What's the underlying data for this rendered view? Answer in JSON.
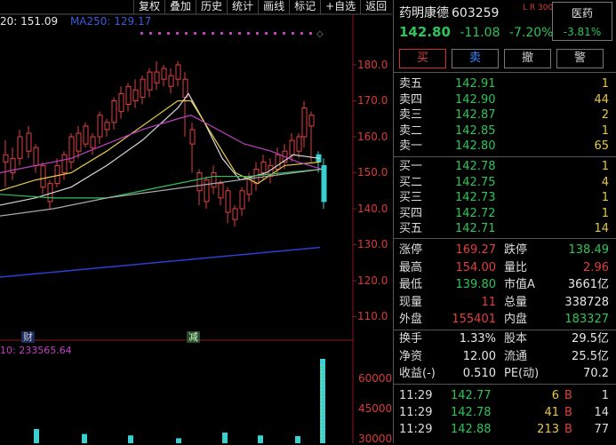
{
  "toolbar": {
    "items": [
      "复权",
      "叠加",
      "历史",
      "统计",
      "画线",
      "标记",
      "+自选",
      "返回"
    ]
  },
  "legend": {
    "ma20": "20: 151.09",
    "ma250": "MA250: 129.17"
  },
  "volume_legend": "10: 233565.64",
  "events": {
    "financial": "财",
    "reduction": "减"
  },
  "price_axis": [
    "180.0",
    "170.0",
    "160.0",
    "150.0",
    "140.0",
    "130.0",
    "120.0",
    "110.0"
  ],
  "volume_axis": [
    "60000",
    "45000",
    "30000"
  ],
  "stock": {
    "name": "药明康德",
    "code": "603259",
    "badge": "L R 300",
    "last": "142.80",
    "change": "-11.08",
    "change_pct": "-7.20%",
    "sector": "医药",
    "sector_change": "-3.81%"
  },
  "buttons": {
    "buy": "买",
    "sell": "卖",
    "cancel": "撤",
    "alert": "警"
  },
  "asks": [
    {
      "label": "卖五",
      "price": "142.91",
      "vol": "1"
    },
    {
      "label": "卖四",
      "price": "142.90",
      "vol": "44"
    },
    {
      "label": "卖三",
      "price": "142.87",
      "vol": "2"
    },
    {
      "label": "卖二",
      "price": "142.85",
      "vol": "1"
    },
    {
      "label": "卖一",
      "price": "142.80",
      "vol": "65"
    }
  ],
  "bids": [
    {
      "label": "买一",
      "price": "142.78",
      "vol": "1"
    },
    {
      "label": "买二",
      "price": "142.75",
      "vol": "4"
    },
    {
      "label": "买三",
      "price": "142.73",
      "vol": "1"
    },
    {
      "label": "买四",
      "price": "142.72",
      "vol": "1"
    },
    {
      "label": "买五",
      "price": "142.71",
      "vol": "14"
    }
  ],
  "stats": [
    {
      "l1": "涨停",
      "v1": "169.27",
      "c1": "red",
      "l2": "跌停",
      "v2": "138.49",
      "c2": "green"
    },
    {
      "l1": "最高",
      "v1": "154.00",
      "c1": "red",
      "l2": "量比",
      "v2": "2.96",
      "c2": "red"
    },
    {
      "l1": "最低",
      "v1": "139.80",
      "c1": "green",
      "l2": "市值A",
      "v2": "3661亿",
      "c2": "white"
    },
    {
      "l1": "现量",
      "v1": "11",
      "c1": "red",
      "l2": "总量",
      "v2": "338728",
      "c2": "white"
    },
    {
      "l1": "外盘",
      "v1": "155401",
      "c1": "red",
      "l2": "内盘",
      "v2": "183327",
      "c2": "green"
    }
  ],
  "stats2": [
    {
      "l1": "换手",
      "v1": "1.33%",
      "c1": "white",
      "l2": "股本",
      "v2": "29.5亿",
      "c2": "white"
    },
    {
      "l1": "净资",
      "v1": "12.00",
      "c1": "white",
      "l2": "流通",
      "v2": "25.5亿",
      "c2": "white"
    },
    {
      "l1": "收益(-)",
      "v1": "0.510",
      "c1": "white",
      "l2": "PE(动)",
      "v2": "70.2",
      "c2": "white"
    }
  ],
  "ticks": [
    {
      "time": "11:29",
      "price": "142.77",
      "vol": "6",
      "side": "B",
      "count": "1"
    },
    {
      "time": "11:29",
      "price": "142.78",
      "vol": "41",
      "side": "B",
      "count": "14"
    },
    {
      "time": "11:29",
      "price": "142.88",
      "vol": "213",
      "side": "B",
      "count": "77"
    }
  ],
  "colors": {
    "up": "#e04040",
    "down": "#2ec45a",
    "ma250": "#2b3fd0",
    "accent": "#c040c0"
  }
}
